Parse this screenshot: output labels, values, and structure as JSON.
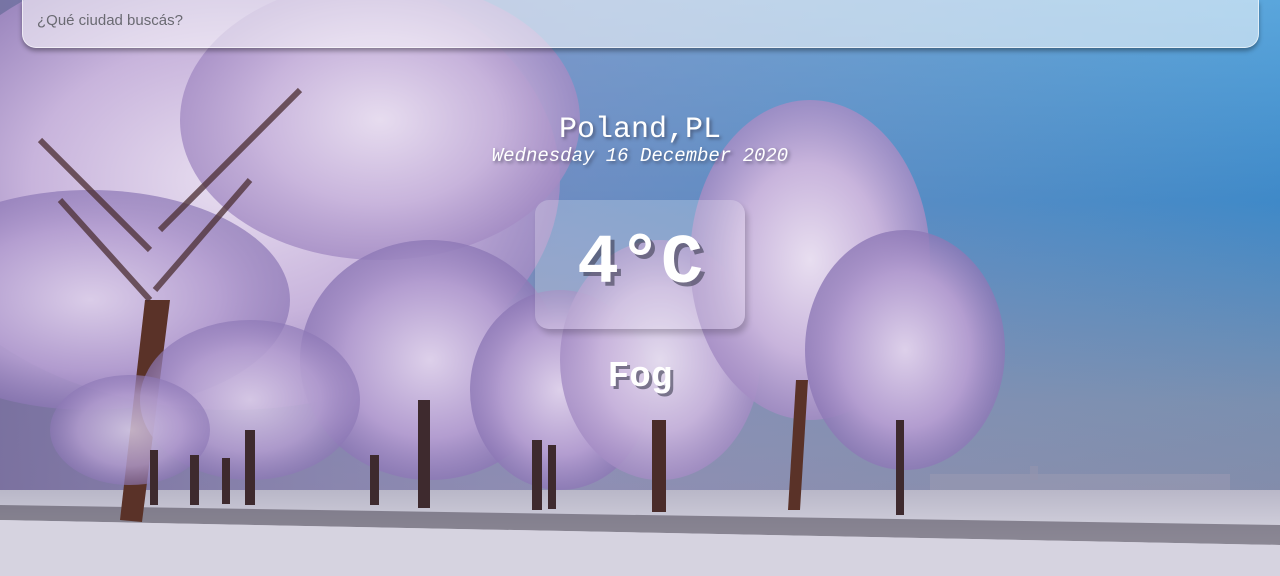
{
  "search": {
    "placeholder": "¿Qué ciudad buscás?",
    "value": ""
  },
  "location": {
    "city": "Poland,PL",
    "date": "Wednesday 16 December 2020"
  },
  "weather": {
    "temperature": "4°C",
    "condition": "Fog"
  },
  "background": {
    "subject": "snow-covered trees in winter",
    "sky_color": "#3a8fd0",
    "snow_color": "#d9d6e3"
  }
}
